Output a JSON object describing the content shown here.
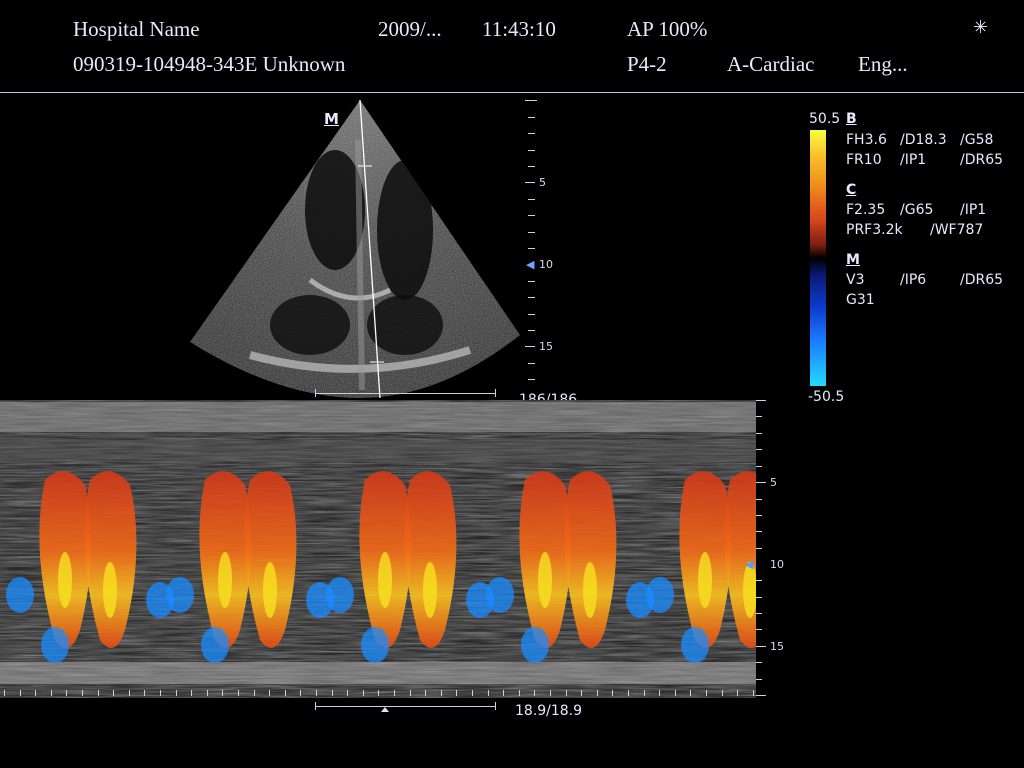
{
  "header": {
    "hospital": "Hospital Name",
    "date": "2009/...",
    "time": "11:43:10",
    "ap": "AP 100%",
    "patient_id": "090319-104948-343E Unknown",
    "probe": "P4-2",
    "preset": "A-Cardiac",
    "lang": "Eng..."
  },
  "icons": {
    "settings": "snowflake-icon"
  },
  "sector": {
    "mode_label": "M",
    "depth_ticks": [
      "5",
      "10",
      "15"
    ],
    "frame_counter": "186/186"
  },
  "colorbar": {
    "max": "50.5",
    "min": "-50.5"
  },
  "params": {
    "b_title": "B",
    "b_row1": [
      "FH3.6",
      "/D18.3",
      "/G58"
    ],
    "b_row2": [
      "FR10",
      "/IP1",
      "/DR65"
    ],
    "c_title": "C",
    "c_row1": [
      "F2.35",
      "/G65",
      "/IP1"
    ],
    "c_row2": [
      "PRF3.2k",
      "/WF787"
    ],
    "m_title": "M",
    "m_row1": [
      "V3",
      "/IP6",
      "/DR65"
    ],
    "m_row2": [
      "G31"
    ]
  },
  "mmode": {
    "depth_ticks": [
      "5",
      "10",
      "15"
    ],
    "time_counter": "18.9/18.9"
  },
  "colors": {
    "flow_red": "#f06a18",
    "flow_yellow": "#f8e020",
    "flow_blue": "#1a8cff"
  }
}
